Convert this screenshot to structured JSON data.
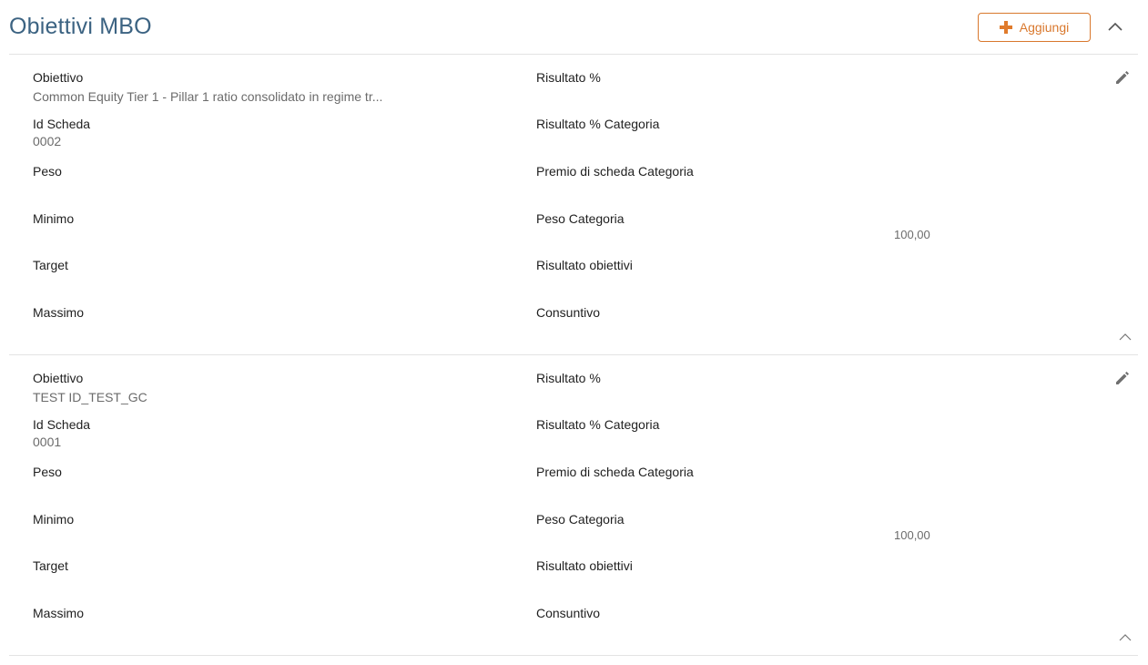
{
  "header": {
    "title": "Obiettivi MBO",
    "add_label": "Aggiungi"
  },
  "labels": {
    "obiettivo": "Obiettivo",
    "id_scheda": "Id Scheda",
    "peso": "Peso",
    "minimo": "Minimo",
    "target": "Target",
    "massimo": "Massimo",
    "risultato_pct": "Risultato %",
    "risultato_pct_categoria": "Risultato % Categoria",
    "premio_scheda_categoria": "Premio di scheda Categoria",
    "peso_categoria": "Peso Categoria",
    "risultato_obiettivi": "Risultato obiettivi",
    "consuntivo": "Consuntivo"
  },
  "cards": [
    {
      "obiettivo": "Common Equity Tier 1 - Pillar 1 ratio consolidato in regime tr...",
      "id_scheda": "0002",
      "peso_categoria_value": "100,00"
    },
    {
      "obiettivo": "TEST ID_TEST_GC",
      "id_scheda": "0001",
      "peso_categoria_value": "100,00"
    }
  ]
}
